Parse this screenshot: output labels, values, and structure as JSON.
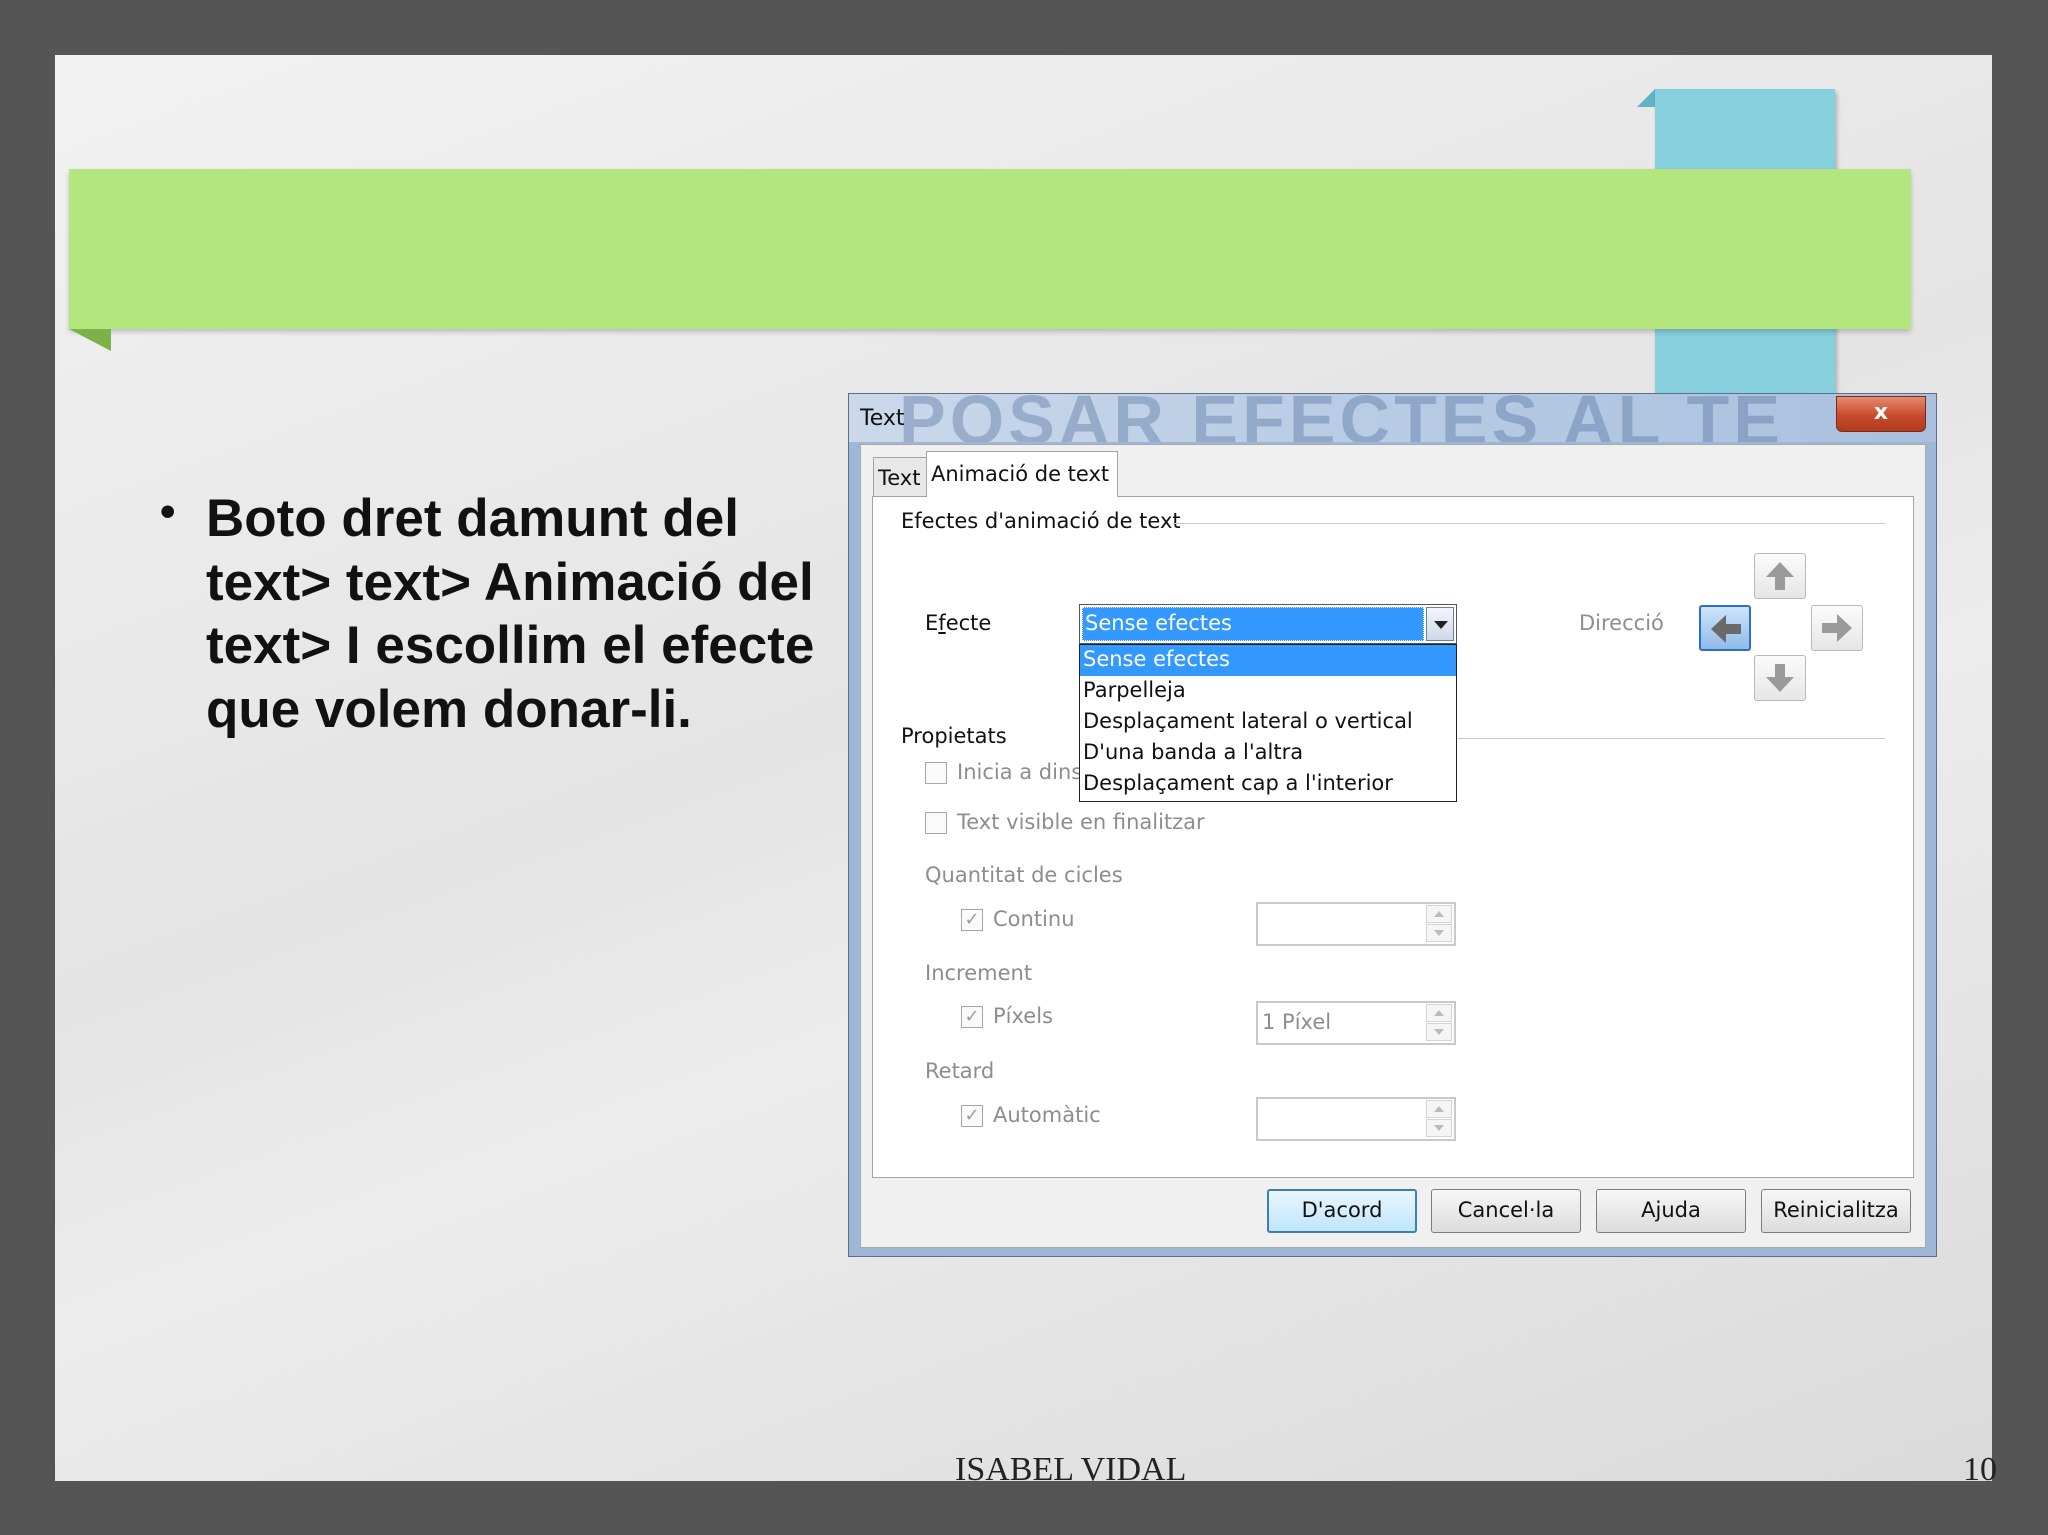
{
  "slide": {
    "bullet": "Boto dret  damunt del text> text> Animació del text> I escollim el efecte que volem donar-li.",
    "footer_author": "ISABEL VIDAL",
    "page_number": "10"
  },
  "dialog": {
    "title": "Text",
    "title_watermark": "POSAR EFECTES AL TE",
    "close_label": "x",
    "tabs": [
      {
        "label": "Text",
        "active": false
      },
      {
        "label": "Animació de text",
        "active": true
      }
    ],
    "group_effects": "Efectes d'animació de text",
    "effect_label": "Efecte",
    "effect_selected": "Sense efectes",
    "effect_options": [
      "Sense efectes",
      "Parpelleja",
      "Desplaçament lateral o vertical",
      "D'una banda a l'altra",
      "Desplaçament cap a l'interior"
    ],
    "direction_label": "Direcció",
    "direction_selected": "left",
    "group_properties": "Propietats",
    "start_inside": "Inicia a dins",
    "text_visible_end": "Text visible en finalitzar",
    "cycles_label": "Quantitat de cicles",
    "continuous": "Continu",
    "increment_label": "Increment",
    "pixels": "Píxels",
    "increment_value": "1 Píxel",
    "delay_label": "Retard",
    "automatic": "Automàtic",
    "buttons": {
      "ok": "D'acord",
      "cancel": "Cancel·la",
      "help": "Ajuda",
      "reset": "Reinicialitza"
    }
  }
}
